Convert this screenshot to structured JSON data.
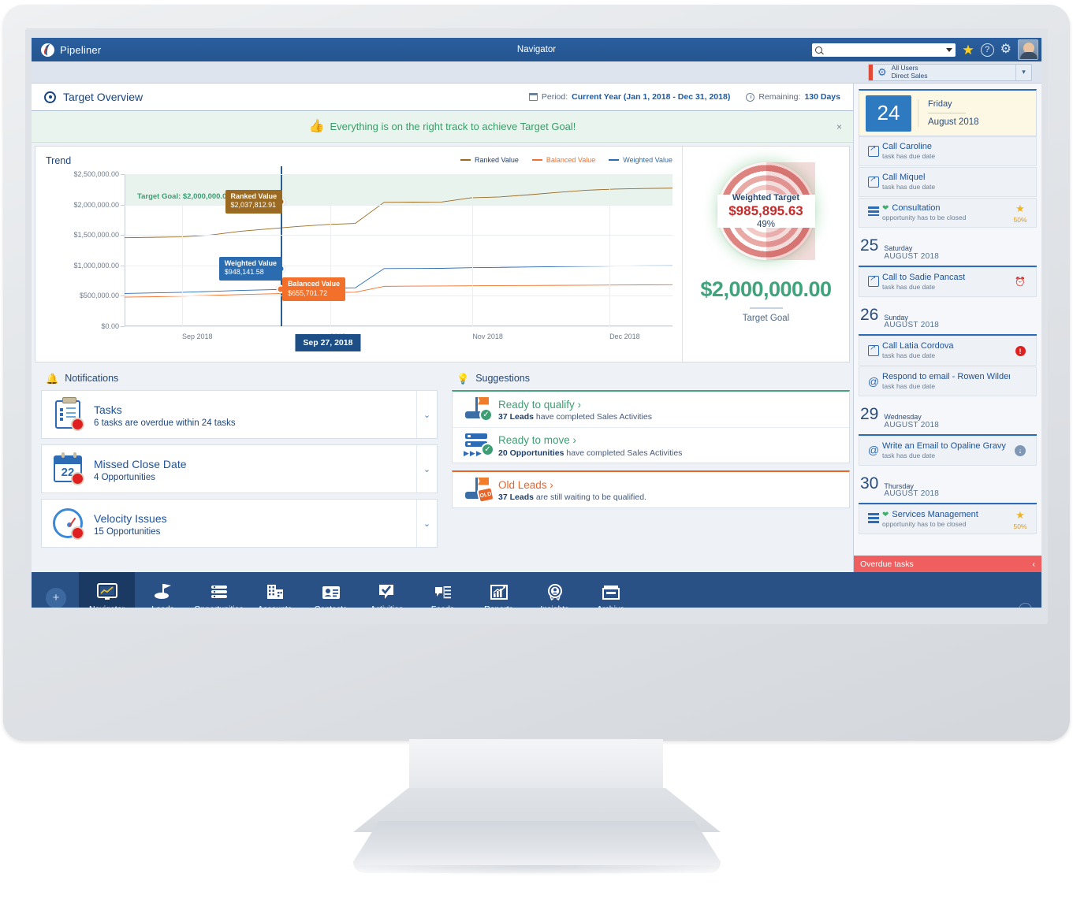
{
  "app": {
    "brand": "Pipeliner",
    "window_title": "Navigator",
    "search_placeholder": "",
    "search_value": "",
    "icons": {
      "star": "star-icon",
      "help": "?",
      "settings": "gear-icon",
      "avatar": "user-avatar"
    },
    "user_filter": {
      "line1": "All Users",
      "line2": "Direct Sales",
      "accent_color": "#e24a35"
    }
  },
  "page": {
    "title": "Target Overview",
    "period_label": "Period:",
    "period_value": "Current Year (Jan 1, 2018 - Dec 31, 2018)",
    "remaining_label": "Remaining:",
    "remaining_value": "130 Days"
  },
  "banner": {
    "text": "Everything is on the right track to achieve Target Goal!",
    "close": "×",
    "color": "#3a9b68"
  },
  "chart_data": {
    "type": "line",
    "title": "Trend",
    "xlabel": "",
    "ylabel": "",
    "ylim": [
      0,
      2500000
    ],
    "yticks": [
      "$0.00",
      "$500,000.00",
      "$1,000,000.00",
      "$1,500,000.00",
      "$2,000,000.00",
      "$2,500,000.00"
    ],
    "ytick_values": [
      0,
      500000,
      1000000,
      1500000,
      2000000,
      2500000
    ],
    "xticks": [
      "Sep 2018",
      "2018",
      "Nov 2018",
      "Dec 2018"
    ],
    "grid": true,
    "legend_position": "top-right",
    "target_goal": 2000000,
    "target_goal_label": "Target Goal: $2,000,000.00",
    "cursor_date": "Sep 27, 2018",
    "series": [
      {
        "name": "Ranked Value",
        "color": "#9b6a22",
        "legend_text_color": "#1b3f6e",
        "marker_value": 2037812.91,
        "marker_label": "Ranked Value",
        "marker_text": "$2,037,812.91",
        "values": [
          1455000,
          1462000,
          1470000,
          1500000,
          1560000,
          1600000,
          1640000,
          1672000,
          1690000,
          2037812,
          2040000,
          2042000,
          2110000,
          2125000,
          2160000,
          2200000,
          2235000,
          2255000,
          2265000,
          2270000
        ]
      },
      {
        "name": "Balanced Value",
        "color": "#f2702a",
        "legend_text_color": "#f2702a",
        "marker_value": 655701.72,
        "marker_label": "Balanced Value",
        "marker_text": "$655,701.72",
        "values": [
          478000,
          485000,
          495000,
          508000,
          520000,
          532000,
          545000,
          552000,
          560000,
          655701,
          660000,
          662000,
          665000,
          668000,
          670000,
          672000,
          675000,
          678000,
          680000,
          682000
        ]
      },
      {
        "name": "Weighted Value",
        "color": "#2b6cb0",
        "legend_text_color": "#2b6cb0",
        "marker_value": 948141.58,
        "marker_label": "Weighted Value",
        "marker_text": "$948,141.58",
        "values": [
          538000,
          548000,
          558000,
          572000,
          588000,
          600000,
          612000,
          622000,
          632000,
          948141,
          950000,
          952000,
          962000,
          968000,
          974000,
          980000,
          985000,
          990000,
          993000,
          995000
        ]
      }
    ]
  },
  "gauge": {
    "label": "Weighted Target",
    "value": "$985,895.63",
    "percent": "49%",
    "goal_value": "$2,000,000.00",
    "goal_label": "Target Goal",
    "goal_color": "#3fa37b",
    "value_color": "#c52b2b"
  },
  "notifications": {
    "title": "Notifications",
    "items": [
      {
        "icon": "clipboard-tasks-icon",
        "title": "Tasks",
        "subtitle": "6 tasks are overdue within 24 tasks",
        "expand": "⌄"
      },
      {
        "icon": "calendar-22-icon",
        "title": "Missed Close Date",
        "subtitle": "4 Opportunities",
        "day": "22",
        "expand": "⌄"
      },
      {
        "icon": "speedometer-icon",
        "title": "Velocity Issues",
        "subtitle": "15 Opportunities",
        "expand": "⌄"
      }
    ]
  },
  "suggestions": {
    "title": "Suggestions",
    "groups": [
      {
        "accent": "green",
        "rows": [
          {
            "icon": "flag-check-icon",
            "title": "Ready to qualify ›",
            "color": "green",
            "count": "37 Leads",
            "rest": " have completed Sales Activities"
          },
          {
            "icon": "stack-move-icon",
            "title": "Ready to move ›",
            "color": "green",
            "count": "20 Opportunities",
            "rest": " have completed Sales Activities"
          }
        ]
      },
      {
        "accent": "orange",
        "rows": [
          {
            "icon": "flag-old-icon",
            "title": "Old Leads ›",
            "color": "orange",
            "count": "37 Leads",
            "rest": " are still waiting to be qualified."
          }
        ]
      }
    ]
  },
  "sidebar": {
    "today": {
      "day_num": "24",
      "weekday": "Friday",
      "month": "August 2018"
    },
    "today_events": [
      {
        "icon": "phone-icon",
        "title": "Call Caroline",
        "sub": "task has due date",
        "right": "",
        "right_sub": ""
      },
      {
        "icon": "phone-icon",
        "title": "Call Miquel",
        "sub": "task has due date",
        "right": "",
        "right_sub": ""
      },
      {
        "icon": "list-icon",
        "heart": true,
        "title": "Consultation",
        "sub": "opportunity has to be closed",
        "right": "star",
        "right_sub": "50%"
      }
    ],
    "days": [
      {
        "num": "25",
        "weekday": "Saturday",
        "month": "AUGUST 2018",
        "events": [
          {
            "icon": "phone-icon",
            "title": "Call to Sadie Pancast",
            "sub": "task has due date",
            "right": "alarm",
            "right_sub": ""
          }
        ]
      },
      {
        "num": "26",
        "weekday": "Sunday",
        "month": "AUGUST 2018",
        "events": [
          {
            "icon": "phone-icon",
            "title": "Call Latia Cordova",
            "sub": "task has due date",
            "right": "alert",
            "right_sub": ""
          },
          {
            "icon": "at-icon",
            "title": "Respond to email - Rowen Wilders…",
            "sub": "task has due date",
            "right": "",
            "right_sub": ""
          }
        ]
      },
      {
        "num": "29",
        "weekday": "Wednesday",
        "month": "AUGUST 2018",
        "events": [
          {
            "icon": "at-icon",
            "title": "Write an Email to Opaline Gravy",
            "sub": "task has due date",
            "right": "down",
            "right_sub": ""
          }
        ]
      },
      {
        "num": "30",
        "weekday": "Thursday",
        "month": "AUGUST 2018",
        "events": [
          {
            "icon": "list-icon",
            "heart": true,
            "title": "Services Management",
            "sub": "opportunity has to be closed",
            "right": "star",
            "right_sub": "50%"
          }
        ]
      }
    ],
    "overdue": {
      "label": "Overdue tasks",
      "chevron": "‹",
      "color": "#ef5f60"
    }
  },
  "bottom_nav": {
    "add_label": "+",
    "collapse": "⌄",
    "items": [
      {
        "icon": "monitor-chart-icon",
        "label": "Navigator",
        "active": true
      },
      {
        "icon": "flag-icon",
        "label": "Leads",
        "active": false
      },
      {
        "icon": "stack-icon",
        "label": "Opportunities",
        "active": false
      },
      {
        "icon": "building-icon",
        "label": "Accounts",
        "active": false
      },
      {
        "icon": "contact-card-icon",
        "label": "Contacts",
        "active": false
      },
      {
        "icon": "check-bubble-icon",
        "label": "Activities",
        "active": false
      },
      {
        "icon": "feed-icon",
        "label": "Feeds",
        "active": false
      },
      {
        "icon": "bar-chart-icon",
        "label": "Reports",
        "active": false
      },
      {
        "icon": "award-icon",
        "label": "Insights",
        "active": false
      },
      {
        "icon": "archive-box-icon",
        "label": "Archive",
        "active": false
      }
    ]
  }
}
